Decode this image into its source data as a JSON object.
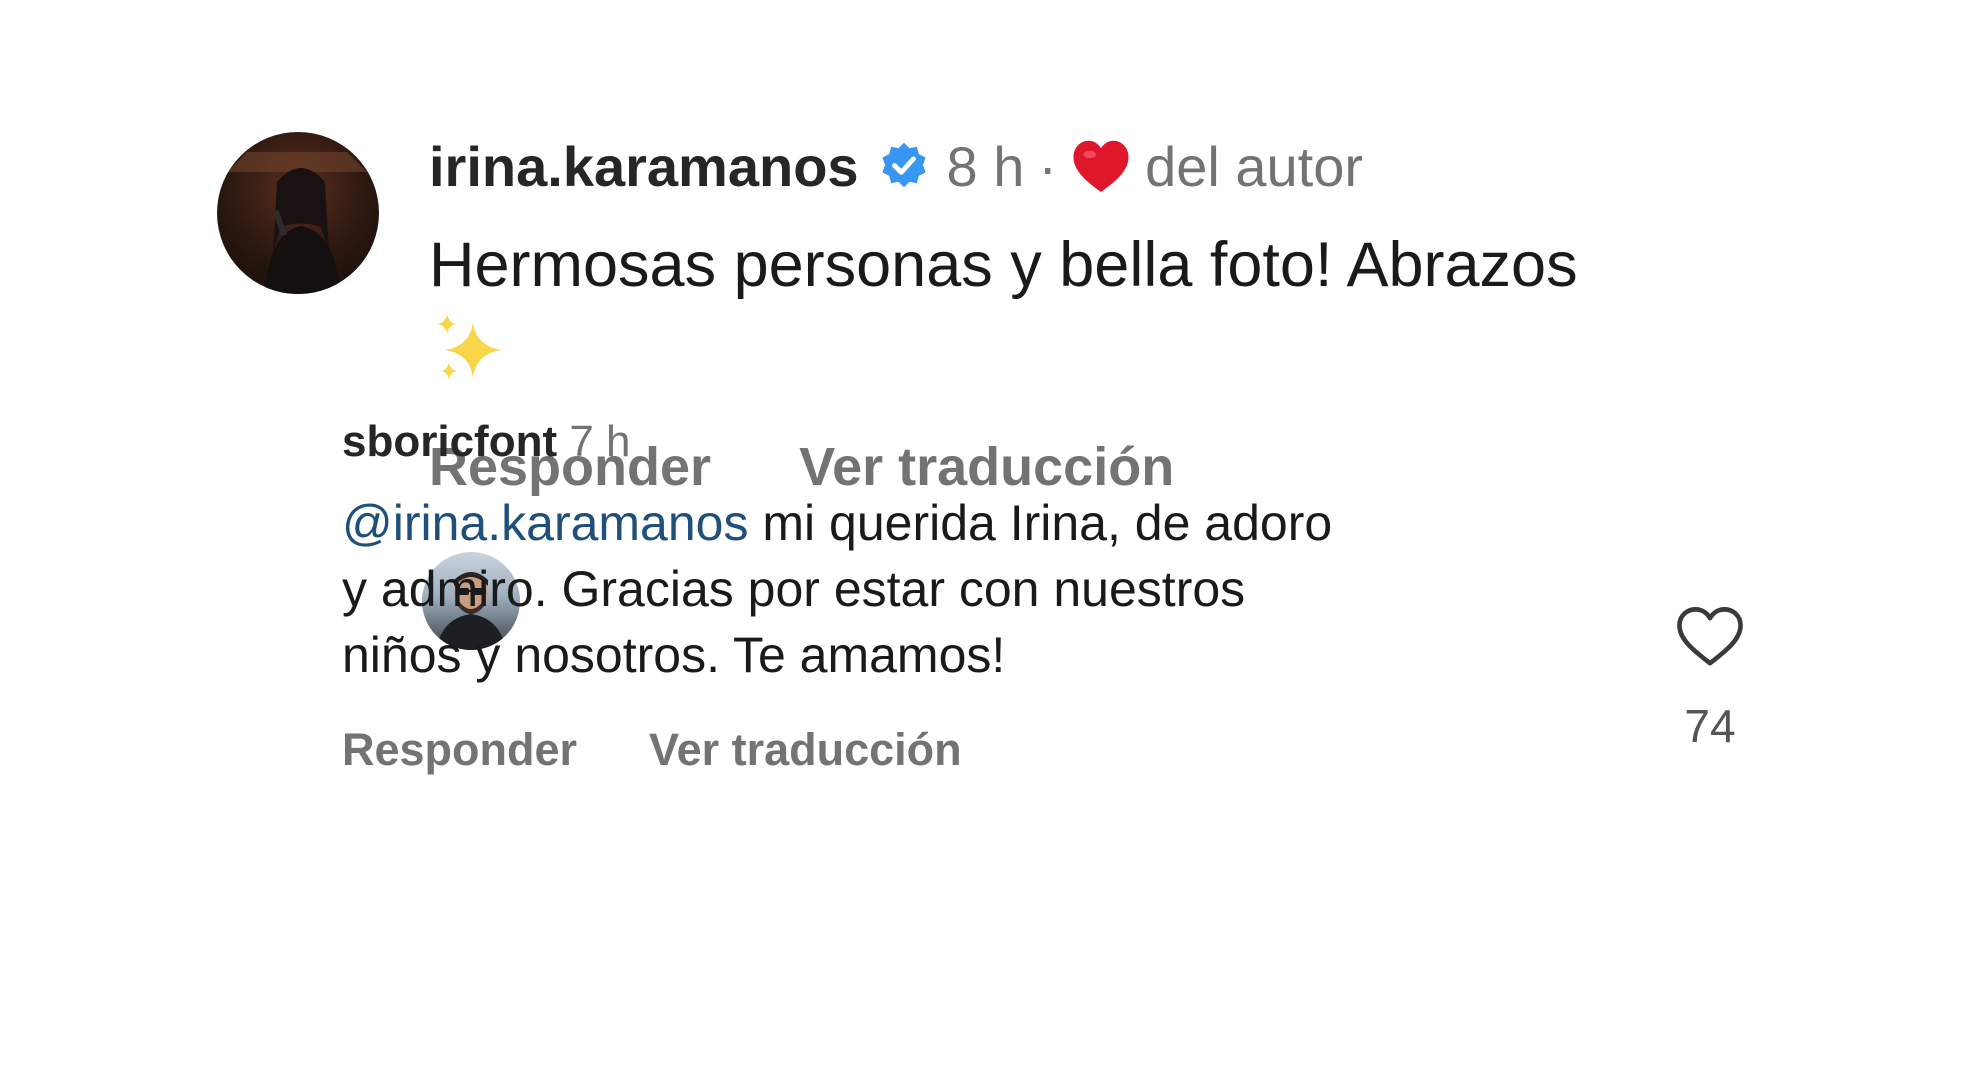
{
  "comment": {
    "username": "irina.karamanos",
    "time": "8 h",
    "separator": "·",
    "liked_by_author": "del autor",
    "text": "Hermosas personas y bella foto! Abrazos",
    "emoji": "sparkles-emoji",
    "actions": {
      "reply": "Responder",
      "translate": "Ver traducción"
    }
  },
  "reply": {
    "username": "sboricfont",
    "time": "7 h",
    "mention": "@irina.karamanos",
    "text": " mi querida Irina, de adoro y admiro. Gracias por estar con nuestros niños y nosotros. Te amamos!",
    "actions": {
      "reply": "Responder",
      "translate": "Ver traducción"
    },
    "like_count": "74"
  },
  "colors": {
    "verified": "#3797f0",
    "heart": "#e0162b",
    "muted": "#737373",
    "mention": "#1f4f7a"
  },
  "icons": {
    "verified": "verified-badge-icon",
    "author_heart": "heart-filled-icon",
    "like": "heart-outline-icon"
  }
}
